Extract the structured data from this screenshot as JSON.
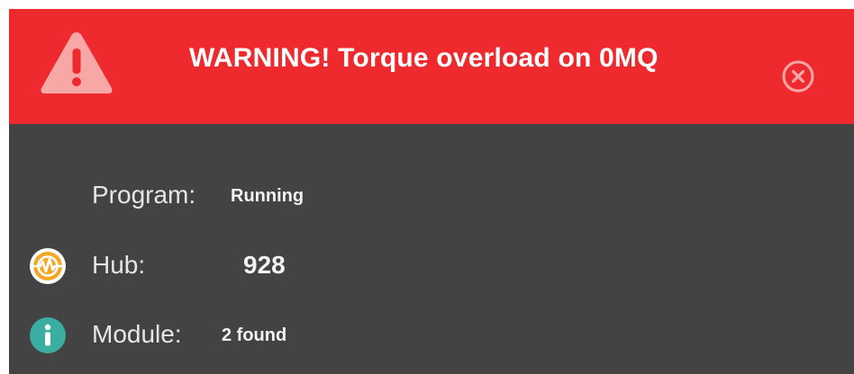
{
  "banner": {
    "message": "WARNING! Torque overload on 0MQ",
    "icon": "warning-triangle-icon",
    "close_icon": "close-circle-icon",
    "background_color": "#ee2a2e"
  },
  "status": {
    "program": {
      "label": "Program:",
      "value": "Running"
    },
    "hub": {
      "label": "Hub:",
      "value": "928",
      "icon": "hub-icon",
      "icon_color": "#f5a623"
    },
    "module": {
      "label": "Module:",
      "value": "2 found",
      "icon": "info-icon",
      "icon_color": "#3aaea0"
    }
  },
  "colors": {
    "panel_background": "#434343",
    "text": "#e6e6e6"
  }
}
